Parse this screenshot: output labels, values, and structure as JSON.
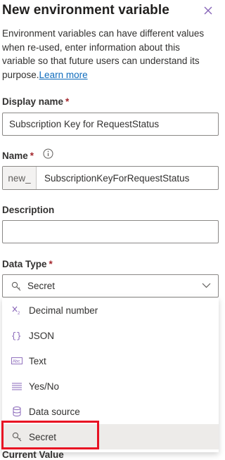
{
  "panel": {
    "title": "New environment variable",
    "description": "Environment variables can have different values when re-used, enter information about this variable so that future users can understand its purpose.",
    "learn_more": "Learn more"
  },
  "display_name": {
    "label": "Display name",
    "required": "*",
    "value": "Subscription Key for RequestStatus"
  },
  "name": {
    "label": "Name",
    "required": "*",
    "prefix": "new_",
    "value": "SubscriptionKeyForRequestStatus"
  },
  "description_field": {
    "label": "Description",
    "value": ""
  },
  "data_type": {
    "label": "Data Type",
    "required": "*",
    "selected": "Secret",
    "options": [
      {
        "label": "Decimal number",
        "icon": "decimal-number-icon"
      },
      {
        "label": "JSON",
        "icon": "braces-icon"
      },
      {
        "label": "Text",
        "icon": "text-abc-icon"
      },
      {
        "label": "Yes/No",
        "icon": "list-icon"
      },
      {
        "label": "Data source",
        "icon": "database-icon"
      },
      {
        "label": "Secret",
        "icon": "key-icon"
      }
    ]
  },
  "current_value": {
    "label": "Current Value"
  },
  "colors": {
    "accent": "#0f6cbd",
    "required": "#a4262c",
    "highlight": "#e81123",
    "selected_bg": "#edebe9"
  }
}
